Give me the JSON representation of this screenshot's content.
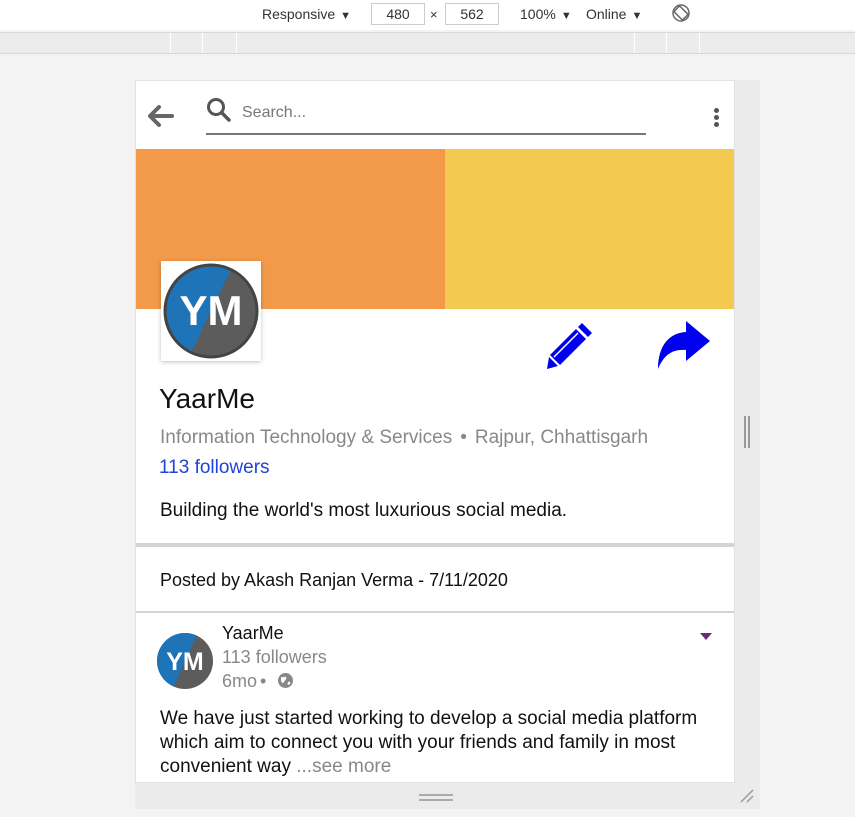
{
  "devtools": {
    "device": "Responsive",
    "width": "480",
    "height": "562",
    "times": "×",
    "zoom": "100%",
    "network": "Online",
    "caret": "▼"
  },
  "search": {
    "placeholder": "Search..."
  },
  "cover_colors": {
    "left": "#f39a4a",
    "right": "#f3c94f"
  },
  "company": {
    "name": "YaarMe",
    "industry": "Information Technology & Services",
    "separator": "•",
    "location": "Rajpur, Chhattisgarh",
    "followers": "113 followers",
    "tagline": "Building the world's most luxurious social media.",
    "logo_text": "YM"
  },
  "posted_by": "Posted by Akash Ranjan Verma - 7/11/2020",
  "post": {
    "author": "YaarMe",
    "followers": "113 followers",
    "age": "6mo",
    "age_sep": "•",
    "body": "We have just started working to develop a social media platform which aim to connect you with your friends and family in most convenient way ",
    "see_more": "...see more"
  },
  "accent_colors": {
    "icon_blue": "#0000ee",
    "link_blue": "#1f43d6",
    "caret_purple": "#6a2a7a"
  }
}
